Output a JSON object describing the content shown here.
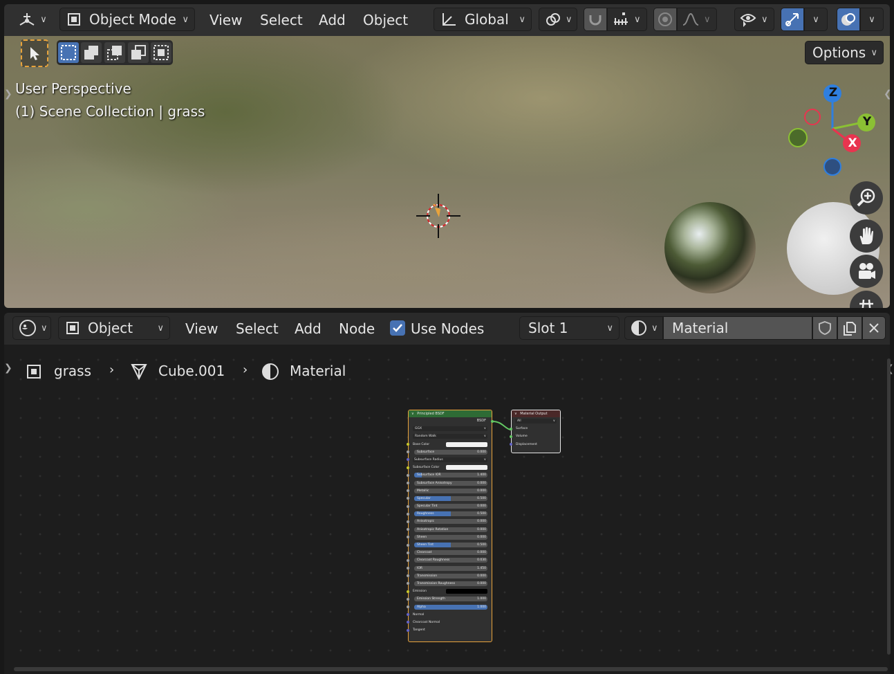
{
  "viewport_header": {
    "editor_type_icon": "3d-viewport-icon",
    "mode_label": "Object Mode",
    "menus": [
      "View",
      "Select",
      "Add",
      "Object"
    ],
    "transform_orientation": "Global"
  },
  "tool_header": {
    "options_label": "Options"
  },
  "viewport": {
    "perspective_label": "User Perspective",
    "collection_label": "(1) Scene Collection | grass",
    "gizmo": {
      "z": "Z",
      "y": "Y",
      "x": "X"
    }
  },
  "node_header": {
    "object_label": "Object",
    "menus": [
      "View",
      "Select",
      "Add",
      "Node"
    ],
    "use_nodes_label": "Use Nodes",
    "use_nodes_checked": true,
    "slot_label": "Slot 1",
    "material_name": "Material"
  },
  "breadcrumb": {
    "object": "grass",
    "mesh": "Cube.001",
    "material": "Material"
  },
  "principled_node": {
    "title": "Principled BSDF",
    "output_label": "BSDF",
    "distribution": "GGX",
    "subsurface_method": "Random Walk",
    "rows": [
      {
        "label": "Base Color",
        "type": "color",
        "swatch": "#f2f2f2",
        "socket": "#c7c729"
      },
      {
        "label": "Subsurface",
        "type": "slider",
        "value": "0.000",
        "fill": 0,
        "socket": "#a1a1a1"
      },
      {
        "label": "Subsurface Radius",
        "type": "dropdown",
        "socket": "#6363c7"
      },
      {
        "label": "Subsurface Color",
        "type": "color",
        "swatch": "#f2f2f2",
        "socket": "#c7c729"
      },
      {
        "label": "Subsurface IOR",
        "type": "slider",
        "value": "1.400",
        "fill": 0.1,
        "socket": "#a1a1a1"
      },
      {
        "label": "Subsurface Anisotropy",
        "type": "slider",
        "value": "0.000",
        "fill": 0,
        "socket": "#a1a1a1"
      },
      {
        "label": "Metallic",
        "type": "slider",
        "value": "0.000",
        "fill": 0,
        "socket": "#a1a1a1"
      },
      {
        "label": "Specular",
        "type": "slider",
        "value": "0.500",
        "fill": 0.5,
        "socket": "#a1a1a1"
      },
      {
        "label": "Specular Tint",
        "type": "slider",
        "value": "0.000",
        "fill": 0,
        "socket": "#a1a1a1"
      },
      {
        "label": "Roughness",
        "type": "slider",
        "value": "0.500",
        "fill": 0.5,
        "socket": "#a1a1a1"
      },
      {
        "label": "Anisotropic",
        "type": "slider",
        "value": "0.000",
        "fill": 0,
        "socket": "#a1a1a1"
      },
      {
        "label": "Anisotropic Rotation",
        "type": "slider",
        "value": "0.000",
        "fill": 0,
        "socket": "#a1a1a1"
      },
      {
        "label": "Sheen",
        "type": "slider",
        "value": "0.000",
        "fill": 0,
        "socket": "#a1a1a1"
      },
      {
        "label": "Sheen Tint",
        "type": "slider",
        "value": "0.500",
        "fill": 0.5,
        "socket": "#a1a1a1"
      },
      {
        "label": "Clearcoat",
        "type": "slider",
        "value": "0.000",
        "fill": 0,
        "socket": "#a1a1a1"
      },
      {
        "label": "Clearcoat Roughness",
        "type": "slider",
        "value": "0.030",
        "fill": 0,
        "socket": "#a1a1a1"
      },
      {
        "label": "IOR",
        "type": "slider",
        "value": "1.450",
        "fill": 0,
        "socket": "#a1a1a1"
      },
      {
        "label": "Transmission",
        "type": "slider",
        "value": "0.000",
        "fill": 0,
        "socket": "#a1a1a1"
      },
      {
        "label": "Transmission Roughness",
        "type": "slider",
        "value": "0.000",
        "fill": 0,
        "socket": "#a1a1a1"
      },
      {
        "label": "Emission",
        "type": "color",
        "swatch": "#000000",
        "socket": "#c7c729"
      },
      {
        "label": "Emission Strength",
        "type": "slider",
        "value": "1.000",
        "fill": 0,
        "socket": "#a1a1a1"
      },
      {
        "label": "Alpha",
        "type": "slider",
        "value": "1.000",
        "fill": 1,
        "socket": "#a1a1a1"
      },
      {
        "label": "Normal",
        "type": "plain",
        "socket": "#6363c7"
      },
      {
        "label": "Clearcoat Normal",
        "type": "plain",
        "socket": "#6363c7"
      },
      {
        "label": "Tangent",
        "type": "plain",
        "socket": "#6363c7"
      }
    ]
  },
  "output_node": {
    "title": "Material Output",
    "target": "All",
    "inputs": [
      {
        "label": "Surface",
        "socket": "#63c763"
      },
      {
        "label": "Volume",
        "socket": "#63c763"
      },
      {
        "label": "Displacement",
        "socket": "#6363c7"
      }
    ]
  },
  "colors": {
    "accent": "#4772b3",
    "active_orange": "#e8a33c",
    "axis_x": "#e8344f",
    "axis_y": "#8bc034",
    "axis_z": "#2f7fdf",
    "node_header_green": "#2e6b35"
  }
}
